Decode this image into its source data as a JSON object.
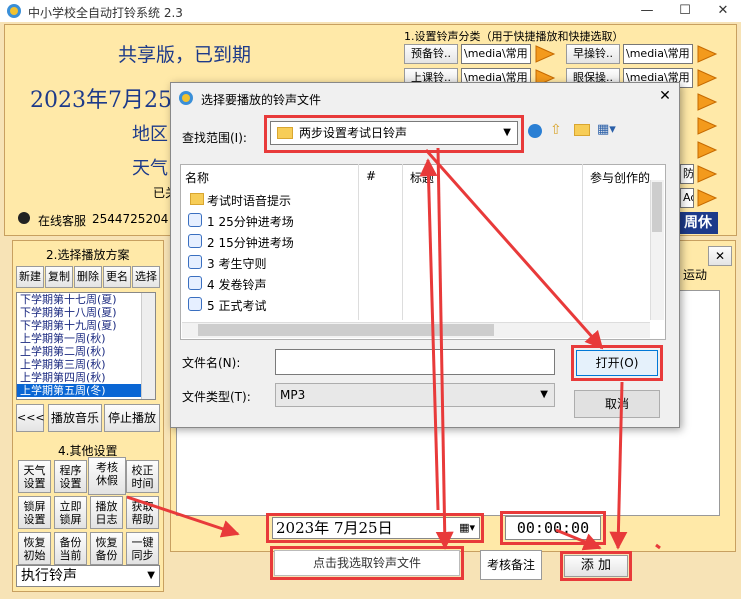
{
  "window": {
    "title": "中小学校全自动打铃系统 2.3",
    "min": "—",
    "max": "☐",
    "close": "✕"
  },
  "banner": {
    "share": "共享版，已到期",
    "date": "2023年7月25日",
    "region": "地区",
    "weather": "天气",
    "status_partial": "已关",
    "service": "在线客服",
    "qq": "2544725204"
  },
  "section1": {
    "title": "1.设置铃声分类（用于快捷播放和快捷选取）",
    "rows": [
      {
        "a_label": "预备铃..",
        "a_path": "\\media\\常用",
        "b_label": "早操铃..",
        "b_path": "\\media\\常用"
      },
      {
        "a_label": "上课铃..",
        "a_path": "\\media\\常用",
        "b_label": "眼保操..",
        "b_path": "\\media\\常用"
      }
    ],
    "partial_labels": [
      "防",
      "Adi"
    ],
    "holiday_btn": "周休"
  },
  "section2": {
    "title": "2.选择播放方案",
    "buttons": [
      "新建",
      "复制",
      "删除",
      "更名",
      "选择"
    ],
    "plans": [
      "下学期第十七周(夏)",
      "下学期第十八周(夏)",
      "下学期第十九周(夏)",
      "上学期第一周(秋)",
      "上学期第二周(秋)",
      "上学期第三周(秋)",
      "上学期第四周(秋)",
      "上学期第五周(冬)"
    ],
    "back": "<<<",
    "play": "播放音乐",
    "stop": "停止播放"
  },
  "section4": {
    "title": "4.其他设置",
    "buttons": [
      [
        "天气\n设置",
        "程序\n设置",
        "考核\n休假",
        "校正\n时间"
      ],
      [
        "锁屏\n设置",
        "立即\n锁屏",
        "播放\n日志",
        "获取\n帮助"
      ],
      [
        "恢复\n初始",
        "备份\n当前",
        "恢复\n备份",
        "一键\n同步"
      ]
    ],
    "dropdown": "执行铃声"
  },
  "right_panel": {
    "partial_text": "运动",
    "close": "✕"
  },
  "bottom": {
    "date_value": "2023年 7月25日",
    "time_value": "00:00:00",
    "select_file": "点击我选取铃声文件",
    "note_btn": "考核备注",
    "add_btn": "添 加"
  },
  "dialog": {
    "title": "选择要播放的铃声文件",
    "look_in_label": "查找范围(I):",
    "look_in_value": "两步设置考试日铃声",
    "columns": [
      "名称",
      "#",
      "标题",
      "参与创作的"
    ],
    "files": [
      {
        "name": "考试时语音提示",
        "type": "folder"
      },
      {
        "name": "1 25分钟进考场",
        "type": "audio"
      },
      {
        "name": "2 15分钟进考场",
        "type": "audio"
      },
      {
        "name": "3 考生守则",
        "type": "audio"
      },
      {
        "name": "4 发卷铃声",
        "type": "audio"
      },
      {
        "name": "5 正式考试",
        "type": "audio"
      }
    ],
    "filename_label": "文件名(N):",
    "filename_value": "",
    "filetype_label": "文件类型(T):",
    "filetype_value": "MP3",
    "open_btn": "打开(O)",
    "cancel_btn": "取消",
    "close": "✕"
  },
  "colors": {
    "accent_red": "#e83a3a",
    "bg_orange": "#f7e3b6",
    "title_blue": "#1d3a8a"
  }
}
